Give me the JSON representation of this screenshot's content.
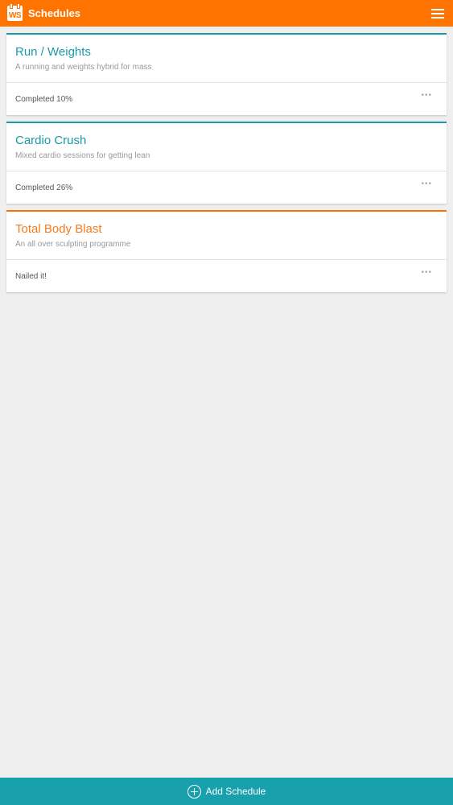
{
  "header": {
    "logo_text": "WS",
    "title": "Schedules"
  },
  "schedules": [
    {
      "title": "Run / Weights",
      "description": "A running and weights hybrid for mass",
      "status": "Completed 10%"
    },
    {
      "title": "Cardio Crush",
      "description": "Mixed cardio sessions for getting lean",
      "status": "Completed 26%"
    },
    {
      "title": "Total Body Blast",
      "description": "An all over sculpting programme",
      "status": "Nailed it!"
    }
  ],
  "more_label": "•••",
  "footer": {
    "add_label": "Add Schedule"
  },
  "colors": {
    "brand_orange": "#ff7300",
    "accent_teal": "#18a0ad"
  },
  "icons": {
    "logo": "calendar-icon",
    "menu": "hamburger-icon",
    "more": "more-horizontal-icon",
    "add": "plus-circle-icon"
  }
}
